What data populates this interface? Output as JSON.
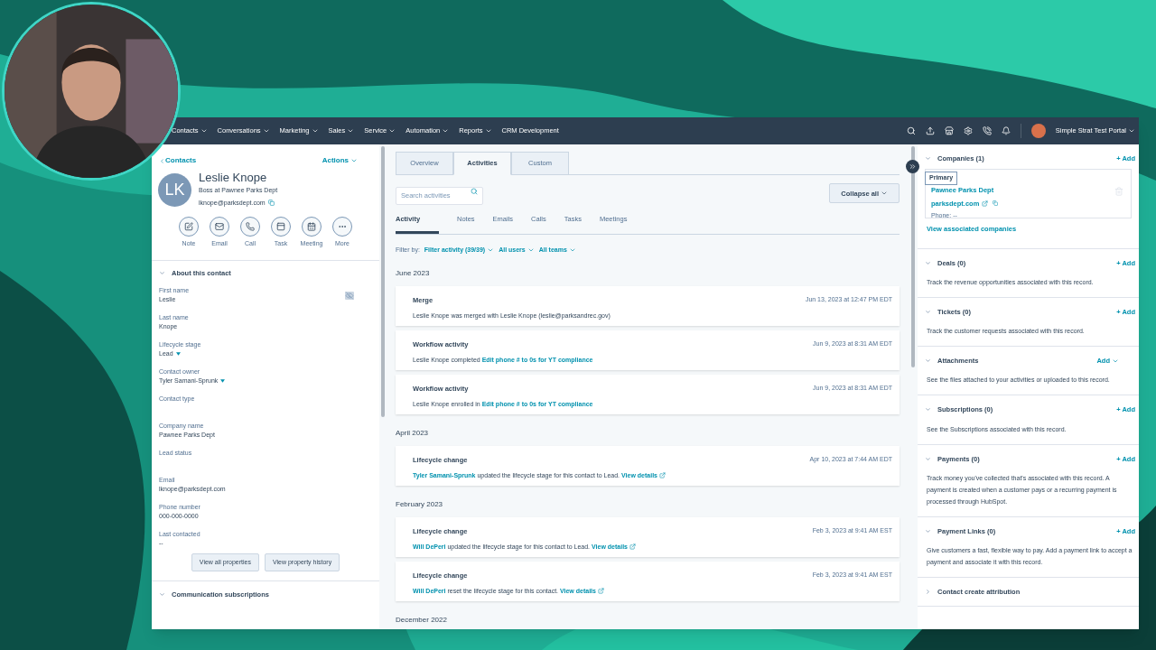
{
  "nav": {
    "items": [
      {
        "label": "Contacts",
        "dropdown": true
      },
      {
        "label": "Conversations",
        "dropdown": true
      },
      {
        "label": "Marketing",
        "dropdown": true
      },
      {
        "label": "Sales",
        "dropdown": true
      },
      {
        "label": "Service",
        "dropdown": true
      },
      {
        "label": "Automation",
        "dropdown": true
      },
      {
        "label": "Reports",
        "dropdown": true
      },
      {
        "label": "CRM Development",
        "dropdown": false
      }
    ],
    "account": "Simple Strat Test Portal"
  },
  "contact": {
    "back": "Contacts",
    "actions": "Actions",
    "initials": "LK",
    "name": "Leslie Knope",
    "job": "Boss at Pawnee Parks Dept",
    "email": "lknope@parksdept.com",
    "quick_actions": [
      "Note",
      "Email",
      "Call",
      "Task",
      "Meeting",
      "More"
    ],
    "section": "About this contact",
    "fields": [
      {
        "label": "First name",
        "value": "Leslie",
        "dropdown": false
      },
      {
        "label": "Last name",
        "value": "Knope",
        "dropdown": false
      },
      {
        "label": "Lifecycle stage",
        "value": "Lead",
        "dropdown": true
      },
      {
        "label": "Contact owner",
        "value": "Tyler Samani-Sprunk",
        "dropdown": true
      },
      {
        "label": "Contact type"
      },
      {
        "label": "Company name",
        "value": "Pawnee Parks Dept",
        "dropdown": false
      },
      {
        "label": "Lead status"
      },
      {
        "label": "Email",
        "value": "lknope@parksdept.com",
        "dropdown": false
      },
      {
        "label": "Phone number",
        "value": "000-000-0000",
        "dropdown": false
      },
      {
        "label": "Last contacted",
        "value": "--",
        "dropdown": false
      }
    ],
    "buttons": [
      "View all properties",
      "View property history"
    ],
    "next_section": "Communication subscriptions"
  },
  "tabs": [
    {
      "label": "Overview",
      "selected": false
    },
    {
      "label": "Activities",
      "selected": true
    },
    {
      "label": "Custom",
      "selected": false
    }
  ],
  "search": {
    "placeholder": "Search activities"
  },
  "collapse": "Collapse all",
  "subtabs": [
    {
      "label": "Activity",
      "selected": true
    },
    {
      "label": "Notes",
      "selected": false
    },
    {
      "label": "Emails",
      "selected": false
    },
    {
      "label": "Calls",
      "selected": false
    },
    {
      "label": "Tasks",
      "selected": false
    },
    {
      "label": "Meetings",
      "selected": false
    }
  ],
  "filter_label": "Filter by:",
  "filters": [
    "Filter activity (39/39)",
    "All users",
    "All teams"
  ],
  "groups": [
    {
      "month": "June 2023",
      "items": [
        {
          "title": "Merge",
          "date": "Jun 13, 2023 at 12:47 PM EDT",
          "body": [
            {
              "kind": "plain",
              "text": "Leslie Knope was merged with Leslie Knope (leslie@parksandrec.gov)"
            }
          ]
        },
        {
          "title": "Workflow activity",
          "date": "Jun 9, 2023 at 8:31 AM EDT",
          "body": [
            {
              "kind": "plain",
              "text": "Leslie Knope completed"
            },
            {
              "kind": "link",
              "text": "Edit phone # to 0s for YT compliance"
            }
          ]
        },
        {
          "title": "Workflow activity",
          "date": "Jun 9, 2023 at 8:31 AM EDT",
          "body": [
            {
              "kind": "plain",
              "text": "Leslie Knope enrolled in"
            },
            {
              "kind": "link",
              "text": "Edit phone # to 0s for YT compliance"
            }
          ]
        }
      ]
    },
    {
      "month": "April 2023",
      "items": [
        {
          "title": "Lifecycle change",
          "date": "Apr 10, 2023 at 7:44 AM EDT",
          "body": [
            {
              "kind": "link",
              "text": "Tyler Samani-Sprunk"
            },
            {
              "kind": "plain",
              "text": "updated the lifecycle stage for this contact to Lead."
            },
            {
              "kind": "external",
              "text": "View details"
            }
          ]
        }
      ]
    },
    {
      "month": "February 2023",
      "items": [
        {
          "title": "Lifecycle change",
          "date": "Feb 3, 2023 at 9:41 AM EST",
          "body": [
            {
              "kind": "link",
              "text": "Will DePeri"
            },
            {
              "kind": "plain",
              "text": "updated the lifecycle stage for this contact to Lead."
            },
            {
              "kind": "external",
              "text": "View details"
            }
          ]
        },
        {
          "title": "Lifecycle change",
          "date": "Feb 3, 2023 at 9:41 AM EST",
          "body": [
            {
              "kind": "link",
              "text": "Will DePeri"
            },
            {
              "kind": "plain",
              "text": "reset the lifecycle stage for this contact."
            },
            {
              "kind": "external",
              "text": "View details"
            }
          ]
        }
      ]
    },
    {
      "month": "December 2022"
    }
  ],
  "companies": {
    "title": "Companies (1)",
    "add": "+ Add",
    "tag": "Primary",
    "name": "Pawnee Parks Dept",
    "domain": "parksdept.com",
    "phone": "Phone: --",
    "view": "View associated companies"
  },
  "sections": [
    {
      "title": "Deals (0)",
      "add": "+ Add",
      "add_menu": false,
      "expanded": true,
      "description": "Track the revenue opportunities associated with this record."
    },
    {
      "title": "Tickets (0)",
      "add": "+ Add",
      "add_menu": false,
      "expanded": true,
      "description": "Track the customer requests associated with this record."
    },
    {
      "title": "Attachments",
      "add": "Add",
      "add_menu": true,
      "expanded": true,
      "description": "See the files attached to your activities or uploaded to this record."
    },
    {
      "title": "Subscriptions (0)",
      "add": "+ Add",
      "add_menu": false,
      "expanded": true,
      "description": "See the Subscriptions associated with this record."
    },
    {
      "title": "Payments (0)",
      "add": "+ Add",
      "add_menu": false,
      "expanded": true,
      "description": "Track money you've collected that's associated with this record. A payment is created when a customer pays or a recurring payment is processed through HubSpot."
    },
    {
      "title": "Payment Links (0)",
      "add": "+ Add",
      "add_menu": false,
      "expanded": true,
      "description": "Give customers a fast, flexible way to pay. Add a payment link to accept a payment and associate it with this record."
    },
    {
      "title": "Contact create attribution",
      "expanded": false
    }
  ]
}
